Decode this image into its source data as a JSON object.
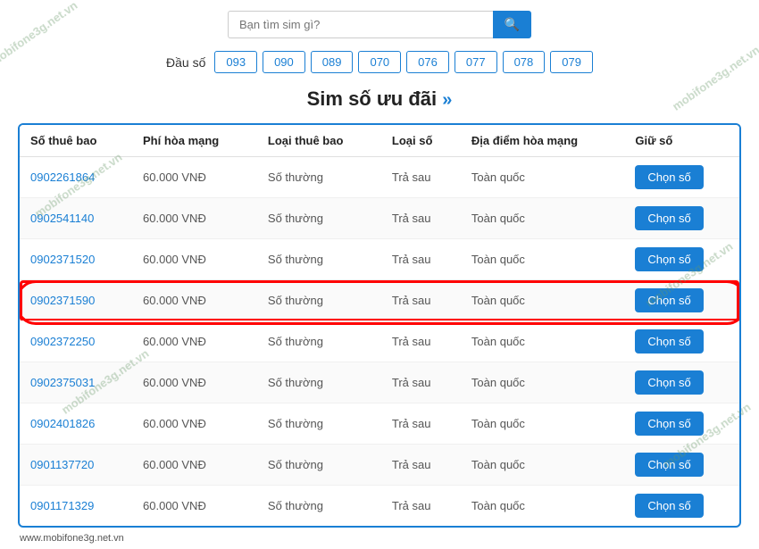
{
  "search": {
    "placeholder": "Bạn tìm sim gì?"
  },
  "prefix": {
    "label": "Đầu số",
    "options": [
      "093",
      "090",
      "089",
      "070",
      "076",
      "077",
      "078",
      "079"
    ]
  },
  "title": "Sim số ưu đãi",
  "table": {
    "headers": [
      "Số thuê bao",
      "Phí hòa mạng",
      "Loại thuê bao",
      "Loại số",
      "Địa điểm hòa mạng",
      "Giữ số"
    ],
    "rows": [
      {
        "phone": "0902261864",
        "fee": "60.000 VNĐ",
        "type": "Số thường",
        "kind": "Trả sau",
        "location": "Toàn quốc",
        "btn": "Chọn số",
        "highlighted": false
      },
      {
        "phone": "0902541140",
        "fee": "60.000 VNĐ",
        "type": "Số thường",
        "kind": "Trả sau",
        "location": "Toàn quốc",
        "btn": "Chọn số",
        "highlighted": false
      },
      {
        "phone": "0902371520",
        "fee": "60.000 VNĐ",
        "type": "Số thường",
        "kind": "Trả sau",
        "location": "Toàn quốc",
        "btn": "Chọn số",
        "highlighted": false
      },
      {
        "phone": "0902371590",
        "fee": "60.000 VNĐ",
        "type": "Số thường",
        "kind": "Trả sau",
        "location": "Toàn quốc",
        "btn": "Chọn số",
        "highlighted": true
      },
      {
        "phone": "0902372250",
        "fee": "60.000 VNĐ",
        "type": "Số thường",
        "kind": "Trả sau",
        "location": "Toàn quốc",
        "btn": "Chọn số",
        "highlighted": false
      },
      {
        "phone": "0902375031",
        "fee": "60.000 VNĐ",
        "type": "Số thường",
        "kind": "Trả sau",
        "location": "Toàn quốc",
        "btn": "Chọn số",
        "highlighted": false
      },
      {
        "phone": "0902401826",
        "fee": "60.000 VNĐ",
        "type": "Số thường",
        "kind": "Trả sau",
        "location": "Toàn quốc",
        "btn": "Chọn số",
        "highlighted": false
      },
      {
        "phone": "0901137720",
        "fee": "60.000 VNĐ",
        "type": "Số thường",
        "kind": "Trả sau",
        "location": "Toàn quốc",
        "btn": "Chọn số",
        "highlighted": false
      },
      {
        "phone": "0901171329",
        "fee": "60.000 VNĐ",
        "type": "Số thường",
        "kind": "Trả sau",
        "location": "Toàn quốc",
        "btn": "Chọn số",
        "highlighted": false
      }
    ]
  },
  "watermarks": [
    "mobifone3g.net.vn",
    "mobifone3g.net.vn"
  ],
  "footer_url": "www.mobifone3g.net.vn"
}
